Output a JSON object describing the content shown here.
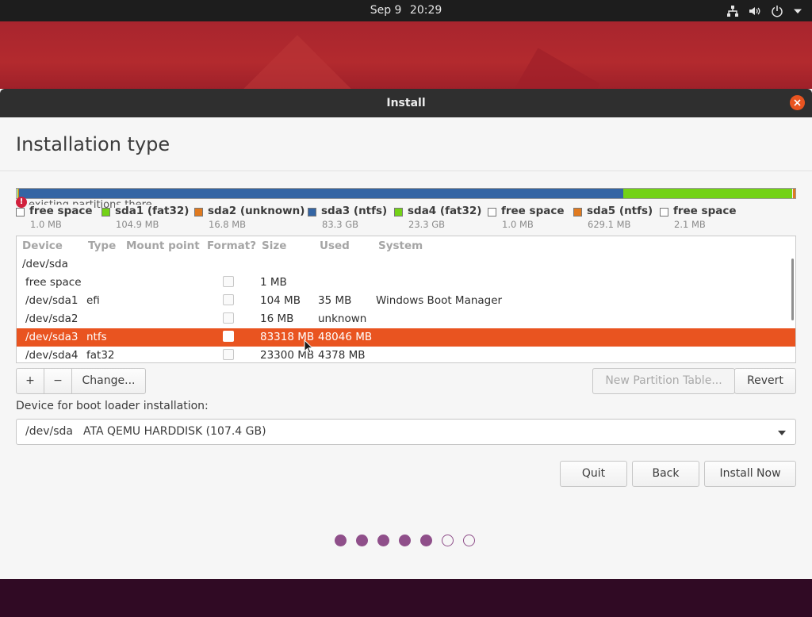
{
  "topbar": {
    "date": "Sep 9",
    "time": "20:29",
    "tray_icons": [
      "network-icon",
      "volume-icon",
      "power-icon",
      "chevron-down-icon"
    ]
  },
  "window": {
    "title": "Install",
    "heading": "Installation type"
  },
  "warning_text": "existing partitions there",
  "partition_bar": [
    {
      "name": "free space",
      "color": "#f2f2f2",
      "size_mb": 1.0
    },
    {
      "name": "sda1 (fat32)",
      "color": "#73d216",
      "size_mb": 104.9
    },
    {
      "name": "sda2 (unknown)",
      "color": "#e07a1f",
      "size_mb": 16.8
    },
    {
      "name": "sda3 (ntfs)",
      "color": "#3465a4",
      "size_mb": 83300
    },
    {
      "name": "sda4 (fat32)",
      "color": "#73d216",
      "size_mb": 23300
    },
    {
      "name": "free space",
      "color": "#f2f2f2",
      "size_mb": 1.0
    },
    {
      "name": "sda5 (ntfs)",
      "color": "#e07a1f",
      "size_mb": 629.1
    },
    {
      "name": "free space",
      "color": "#f2f2f2",
      "size_mb": 2.1
    }
  ],
  "legend": [
    {
      "name": "free space",
      "size": "1.0 MB",
      "color": "#ffffff"
    },
    {
      "name": "sda1 (fat32)",
      "size": "104.9 MB",
      "color": "#73d216"
    },
    {
      "name": "sda2 (unknown)",
      "size": "16.8 MB",
      "color": "#e07a1f"
    },
    {
      "name": "sda3 (ntfs)",
      "size": "83.3 GB",
      "color": "#3465a4"
    },
    {
      "name": "sda4 (fat32)",
      "size": "23.3 GB",
      "color": "#73d216"
    },
    {
      "name": "free space",
      "size": "1.0 MB",
      "color": "#ffffff"
    },
    {
      "name": "sda5 (ntfs)",
      "size": "629.1 MB",
      "color": "#e07a1f"
    },
    {
      "name": "free space",
      "size": "2.1 MB",
      "color": "#ffffff"
    }
  ],
  "table": {
    "headers": {
      "device": "Device",
      "type": "Type",
      "mount": "Mount point",
      "format": "Format?",
      "size": "Size",
      "used": "Used",
      "system": "System"
    },
    "rows": [
      {
        "device": "/dev/sda",
        "type": "",
        "mount": "",
        "format": false,
        "show_format": false,
        "size": "",
        "used": "",
        "system": "",
        "selected": false,
        "indent": false
      },
      {
        "device": "free space",
        "type": "",
        "mount": "",
        "format": false,
        "show_format": true,
        "size": "1 MB",
        "used": "",
        "system": "",
        "selected": false,
        "indent": true
      },
      {
        "device": "/dev/sda1",
        "type": "efi",
        "mount": "",
        "format": false,
        "show_format": true,
        "size": "104 MB",
        "used": "35 MB",
        "system": "Windows Boot Manager",
        "selected": false,
        "indent": true
      },
      {
        "device": "/dev/sda2",
        "type": "",
        "mount": "",
        "format": false,
        "show_format": true,
        "size": "16 MB",
        "used": "unknown",
        "system": "",
        "selected": false,
        "indent": true
      },
      {
        "device": "/dev/sda3",
        "type": "ntfs",
        "mount": "",
        "format": false,
        "show_format": true,
        "size": "83318 MB",
        "used": "48046 MB",
        "system": "",
        "selected": true,
        "indent": true
      },
      {
        "device": "/dev/sda4",
        "type": "fat32",
        "mount": "",
        "format": false,
        "show_format": true,
        "size": "23300 MB",
        "used": "4378 MB",
        "system": "",
        "selected": false,
        "indent": true
      }
    ]
  },
  "buttons": {
    "add": "+",
    "remove": "−",
    "change": "Change...",
    "new_partition_table": "New Partition Table...",
    "revert": "Revert",
    "quit": "Quit",
    "back": "Back",
    "install_now": "Install Now"
  },
  "bootloader": {
    "label": "Device for boot loader installation:",
    "device": "/dev/sda",
    "description": "ATA QEMU HARDDISK (107.4 GB)"
  },
  "progress": {
    "total_steps": 7,
    "completed_steps": 5
  },
  "colors": {
    "accent": "#e95420",
    "progress_dot": "#8f4f8a",
    "titlebar": "#2f2f2f"
  }
}
